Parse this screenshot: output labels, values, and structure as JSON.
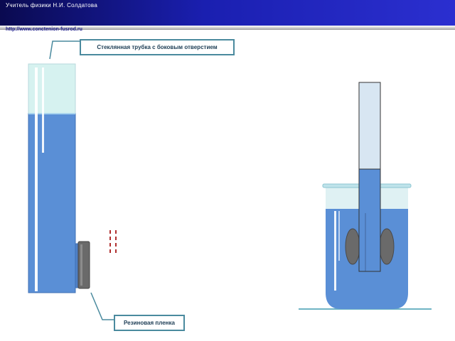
{
  "header": {
    "title": "Учитель физики Н.И. Солдатова",
    "url": "http://www.conctenion-fusrod.ru"
  },
  "labels": {
    "glass_tube": "Стеклянная трубка с боковым отверстием",
    "rubber_film": "Резиновая пленка"
  },
  "colors": {
    "water": "#5a8fd6",
    "glass": "#d6f2f0",
    "rubber": "#6a6a6a",
    "pressure_marks": "#b03030",
    "callout_border": "#4a8a9e"
  }
}
